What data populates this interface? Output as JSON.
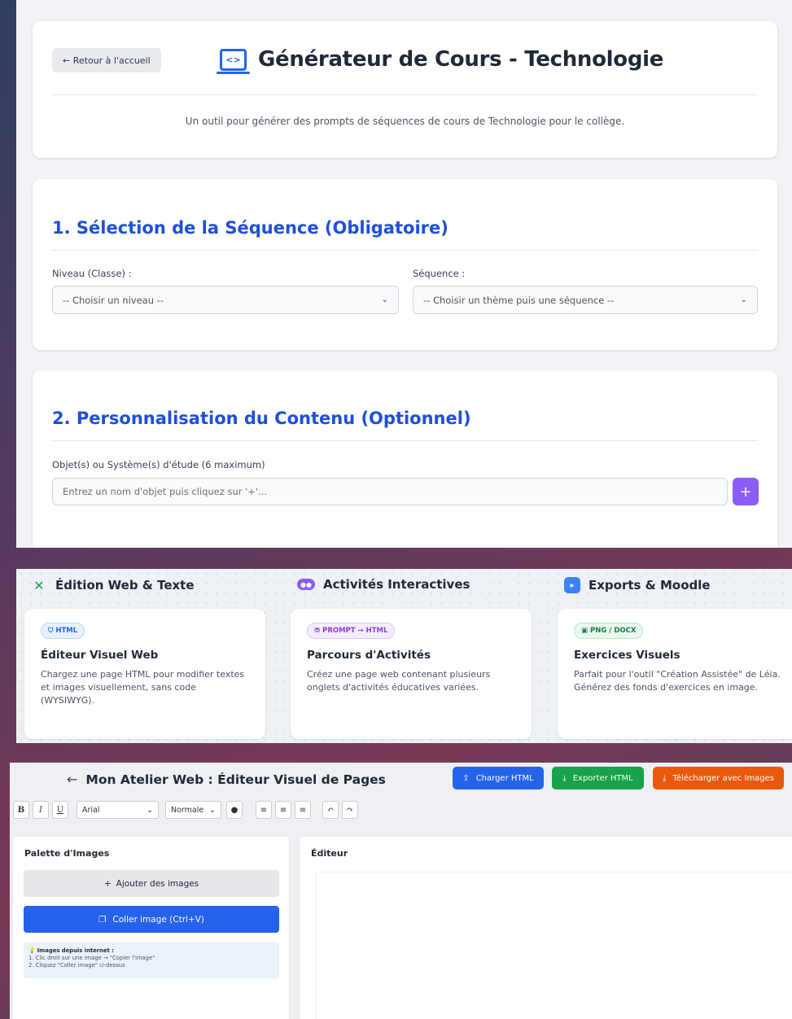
{
  "header": {
    "back_label": "← Retour à l'accueil",
    "icon": "laptop-code-icon",
    "title": "Générateur de Cours - Technologie",
    "description": "Un outil pour générer des prompts de séquences de cours de Technologie pour le collège."
  },
  "section1": {
    "title": "1. Sélection de la Séquence (Obligatoire)",
    "niveau_label": "Niveau (Classe) :",
    "niveau_value": "-- Choisir un niveau --",
    "sequence_label": "Séquence :",
    "sequence_value": "-- Choisir un thème puis une séquence --"
  },
  "section2": {
    "title": "2. Personnalisation du Contenu (Optionnel)",
    "object_label": "Objet(s) ou Système(s) d'étude (6 maximum)",
    "object_placeholder": "Entrez un nom d'objet puis cliquez sur '+'...",
    "add_label": "+"
  },
  "tools": {
    "columns": [
      {
        "title": "Édition Web & Texte",
        "icon": "tools-icon",
        "color": "#16a34a"
      },
      {
        "title": "Activités Interactives",
        "icon": "gamepad-icon",
        "color": "#8b5cf6"
      },
      {
        "title": "Exports & Moodle",
        "icon": "file-export-icon",
        "color": "#3b82f6"
      }
    ],
    "cards": [
      {
        "badge": "HTML",
        "title": "Éditeur Visuel Web",
        "desc": "Chargez une page HTML pour modifier textes et images visuellement, sans code (WYSIWYG)."
      },
      {
        "badge": "PROMPT → HTML",
        "title": "Parcours d'Activités",
        "desc": "Créez une page web contenant plusieurs onglets d'activités éducatives variées."
      },
      {
        "badge": "PNG / DOCX",
        "title": "Exercices Visuels",
        "desc": "Parfait pour l'outil \"Création Assistée\" de Léia. Générez des fonds d'exercices en image."
      }
    ]
  },
  "atelier": {
    "back_arrow": "←",
    "title": "Mon Atelier Web : Éditeur Visuel de Pages",
    "buttons": {
      "load": "Charger HTML",
      "export": "Exporter HTML",
      "download": "Télécharger avec Images"
    },
    "toolbar": {
      "bold": "B",
      "italic": "I",
      "underline": "U",
      "font": "Arial",
      "size": "Normale"
    },
    "palette": {
      "title": "Palette d'Images",
      "add_images": "Ajouter des images",
      "paste_image": "Coller image (Ctrl+V)",
      "hint_title": "Images depuis internet :",
      "hint_step1": "1. Clic droit sur une image → \"Copier l'image\"",
      "hint_step2": "2. Cliquez \"Coller image\" ci-dessus"
    },
    "editor_title": "Éditeur"
  }
}
